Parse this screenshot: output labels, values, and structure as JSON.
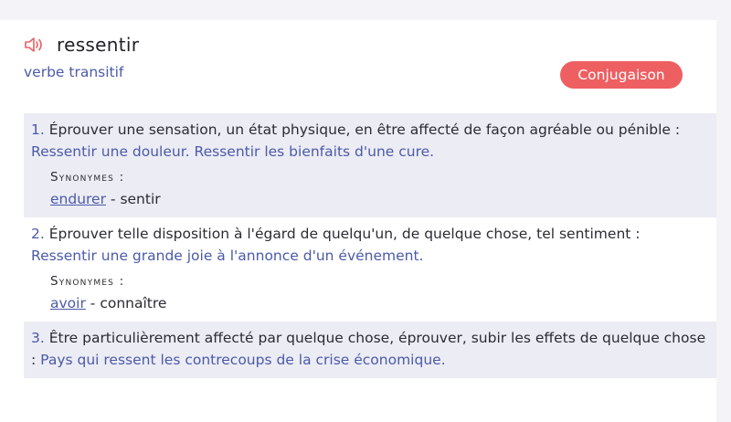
{
  "entry": {
    "word": "ressentir",
    "speaker_icon": "speaker-icon",
    "part_of_speech": "verbe transitif",
    "conjugation_button": "Conjugaison"
  },
  "colors": {
    "accent": "#4b5aa8",
    "button": "#ee5f62",
    "alt_row": "#ececf5"
  },
  "definitions": [
    {
      "number": "1.",
      "text": "Éprouver une sensation, un état physique, en être affecté de façon agréable ou pénible :",
      "example": "Ressentir une douleur. Ressentir les bienfaits d'une cure.",
      "synonyms_label": "Synonymes :",
      "synonyms": [
        {
          "word": "endurer",
          "link": true
        },
        {
          "word": "sentir",
          "link": false
        }
      ]
    },
    {
      "number": "2.",
      "text": "Éprouver telle disposition à l'égard de quelqu'un, de quelque chose, tel sentiment :",
      "example": "Ressentir une grande joie à l'annonce d'un événement.",
      "synonyms_label": "Synonymes :",
      "synonyms": [
        {
          "word": "avoir",
          "link": true
        },
        {
          "word": "connaître",
          "link": false
        }
      ]
    },
    {
      "number": "3.",
      "text": "Être particulièrement affecté par quelque chose, éprouver, subir les effets de quelque chose :",
      "example": "Pays qui ressent les contrecoups de la crise économique."
    }
  ]
}
